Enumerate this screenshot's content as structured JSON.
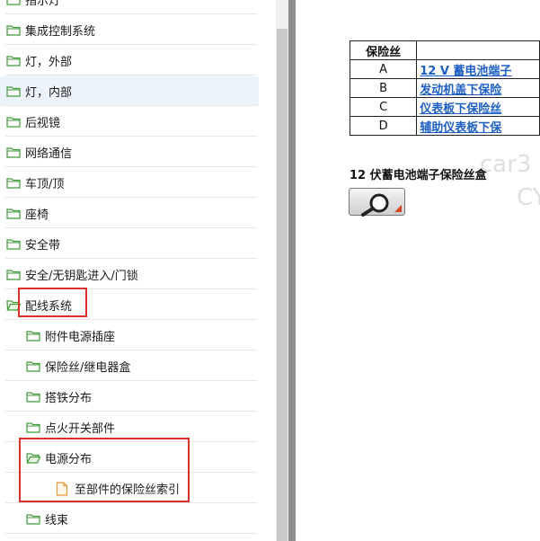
{
  "tree": {
    "items": [
      {
        "label": "指示灯",
        "level": 0,
        "type": "folder",
        "selected": false
      },
      {
        "label": "集成控制系统",
        "level": 0,
        "type": "folder",
        "selected": false
      },
      {
        "label": "灯，外部",
        "level": 0,
        "type": "folder",
        "selected": false
      },
      {
        "label": "灯，内部",
        "level": 0,
        "type": "folder",
        "selected": true
      },
      {
        "label": "后视镜",
        "level": 0,
        "type": "folder",
        "selected": false
      },
      {
        "label": "网络通信",
        "level": 0,
        "type": "folder",
        "selected": false
      },
      {
        "label": "车顶/顶",
        "level": 0,
        "type": "folder",
        "selected": false
      },
      {
        "label": "座椅",
        "level": 0,
        "type": "folder",
        "selected": false
      },
      {
        "label": "安全带",
        "level": 0,
        "type": "folder",
        "selected": false
      },
      {
        "label": "安全/无钥匙进入/门锁",
        "level": 0,
        "type": "folder",
        "selected": false
      },
      {
        "label": "配线系统",
        "level": 0,
        "type": "folder-open",
        "selected": false
      },
      {
        "label": "附件电源插座",
        "level": 1,
        "type": "folder",
        "selected": false
      },
      {
        "label": "保险丝/继电器盒",
        "level": 1,
        "type": "folder",
        "selected": false
      },
      {
        "label": "搭铁分布",
        "level": 1,
        "type": "folder",
        "selected": false
      },
      {
        "label": "点火开关部件",
        "level": 1,
        "type": "folder",
        "selected": false
      },
      {
        "label": "电源分布",
        "level": 1,
        "type": "folder-open",
        "selected": false
      },
      {
        "label": "至部件的保险丝索引",
        "level": 2,
        "type": "document",
        "selected": false
      },
      {
        "label": "线束",
        "level": 1,
        "type": "folder",
        "selected": false
      }
    ]
  },
  "fuse_table": {
    "headers": [
      "保险丝",
      ""
    ],
    "rows": [
      {
        "fuse": "A",
        "link": "12 V 蓄电池端子"
      },
      {
        "fuse": "B",
        "link": "发动机盖下保险"
      },
      {
        "fuse": "C",
        "link": "仪表板下保险丝"
      },
      {
        "fuse": "D",
        "link": "辅助仪表板下保"
      }
    ]
  },
  "section": {
    "heading": "12 伏蓄电池端子保险丝盒"
  },
  "watermark": {
    "line1": "car3",
    "line2": "CY"
  },
  "colors": {
    "link": "#1d5fc2",
    "highlight_box": "#d9302c",
    "selected_row": "#edf3fb",
    "folder": "#3f9a3a"
  },
  "icons": {
    "folder": "folder-icon",
    "folder_open": "folder-open-icon",
    "document": "document-icon",
    "zoom": "magnifier-icon"
  }
}
